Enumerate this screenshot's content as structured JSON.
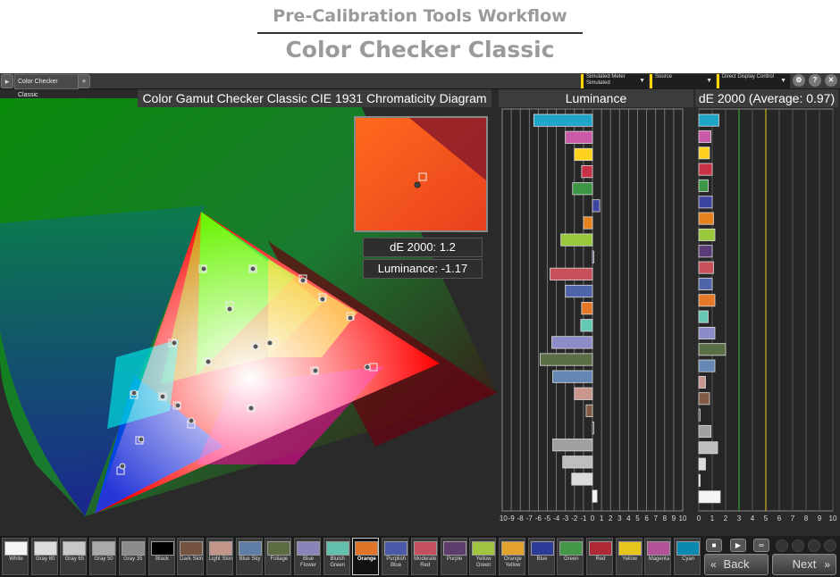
{
  "header": {
    "title": "Pre-Calibration Tools Workflow",
    "subtitle": "Color Checker Classic"
  },
  "tabbar": {
    "tab_label": "Color Checker Classic",
    "dropdowns": [
      {
        "line1": "Simulated Meter",
        "line2": "Simulated"
      },
      {
        "line1": "Source",
        "line2": ""
      },
      {
        "line1": "Direct Display Control",
        "line2": ""
      }
    ],
    "icons": [
      "gear-icon",
      "help-icon",
      "close-icon"
    ]
  },
  "diagram": {
    "title": "Color Gamut Checker Classic CIE 1931 Chromaticity Diagram",
    "de_label": "dE 2000: 1.2",
    "lum_label": "Luminance: -1.17"
  },
  "luminance": {
    "title": "Luminance",
    "ticks": [
      "-10",
      "-9",
      "-8",
      "-7",
      "-6",
      "-5",
      "-4",
      "-3",
      "-2",
      "-1",
      "0",
      "1",
      "2",
      "3",
      "4",
      "5",
      "6",
      "7",
      "8",
      "9",
      "10"
    ],
    "values": [
      -6.5,
      -3,
      -2,
      -1.2,
      -2.2,
      0.8,
      -1,
      -3.5,
      0,
      -4.7,
      -3,
      -1.2,
      -1.3,
      -4.5,
      -5.8,
      -4.4,
      -2,
      -0.7,
      0,
      -4.4,
      -3.3,
      -2.3,
      0.5
    ],
    "colors": [
      "#1fa5c8",
      "#c85aa8",
      "#ffd21e",
      "#c83246",
      "#3c9646",
      "#3c46a0",
      "#e6821e",
      "#9ac83c",
      "#5a3c78",
      "#c8505a",
      "#5064aa",
      "#e67828",
      "#64c8b4",
      "#8c8cc8",
      "#5a6e46",
      "#6487b4",
      "#c8968c",
      "#825a46",
      "#1a1a1a",
      "#a0a0a0",
      "#bebebe",
      "#dcdcdc",
      "#f5f5f5"
    ]
  },
  "de": {
    "title": "dE 2000 (Average: 0.97)",
    "ticks": [
      "0",
      "1",
      "2",
      "3",
      "4",
      "5",
      "6",
      "7",
      "8",
      "9",
      "10"
    ],
    "values": [
      1.5,
      0.9,
      0.8,
      1.0,
      0.7,
      1.0,
      1.1,
      1.2,
      1.0,
      1.1,
      1.0,
      1.2,
      0.7,
      1.2,
      2.0,
      1.2,
      0.5,
      0.8,
      0,
      0.9,
      1.4,
      0.5,
      0.1,
      1.6
    ],
    "colors": [
      "#1fa5c8",
      "#c85aa8",
      "#ffd21e",
      "#c83246",
      "#3c9646",
      "#3c46a0",
      "#e6821e",
      "#9ac83c",
      "#5a3c78",
      "#c8505a",
      "#5064aa",
      "#e67828",
      "#64c8b4",
      "#8c8cc8",
      "#5a6e46",
      "#6487b4",
      "#c8968c",
      "#825a46",
      "#1a1a1a",
      "#a0a0a0",
      "#bebebe",
      "#dcdcdc",
      "#eeeeee",
      "#f5f5f5"
    ]
  },
  "swatches": [
    {
      "label": "White",
      "color": "#f5f5f5"
    },
    {
      "label": "Gray 80",
      "color": "#dcdcdc"
    },
    {
      "label": "Gray 65",
      "color": "#c8c8c8"
    },
    {
      "label": "Gray 50",
      "color": "#aaaaaa"
    },
    {
      "label": "Gray 35",
      "color": "#8c8c8c"
    },
    {
      "label": "Black",
      "color": "#000000"
    },
    {
      "label": "Dark Skin",
      "color": "#73523f"
    },
    {
      "label": "Light Skin",
      "color": "#c4968a"
    },
    {
      "label": "Blue Sky",
      "color": "#5e7ea8"
    },
    {
      "label": "Foliage",
      "color": "#5c6b42"
    },
    {
      "label": "Blue Flower",
      "color": "#8a85b8"
    },
    {
      "label": "Bluish Green",
      "color": "#62c0ac"
    },
    {
      "label": "Orange",
      "color": "#e07428"
    },
    {
      "label": "Purplish Blue",
      "color": "#4a5aa8"
    },
    {
      "label": "Moderate Red",
      "color": "#c2505e"
    },
    {
      "label": "Purple",
      "color": "#5e3c6e"
    },
    {
      "label": "Yellow Green",
      "color": "#9ec440"
    },
    {
      "label": "Orange Yellow",
      "color": "#e4a22e"
    },
    {
      "label": "Blue",
      "color": "#2c3c98"
    },
    {
      "label": "Green",
      "color": "#449648"
    },
    {
      "label": "Red",
      "color": "#b02a36"
    },
    {
      "label": "Yellow",
      "color": "#e8c61c"
    },
    {
      "label": "Magenta",
      "color": "#b45298"
    },
    {
      "label": "Cyan",
      "color": "#0a8ab0"
    }
  ],
  "selected_swatch": "Orange",
  "nav": {
    "back_label": "Back",
    "next_label": "Next"
  }
}
